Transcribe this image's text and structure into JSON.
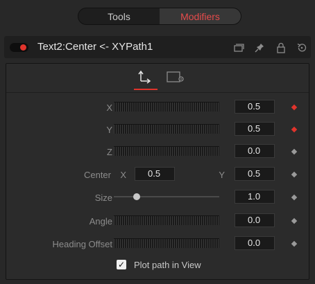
{
  "tabs": {
    "tools": "Tools",
    "modifiers": "Modifiers"
  },
  "header": {
    "title": "Text2:Center <- XYPath1",
    "enabled": true
  },
  "panel_tabs": [
    {
      "name": "controls-tab-icon",
      "active": true
    },
    {
      "name": "settings-tab-icon",
      "active": false
    }
  ],
  "rows": {
    "x": {
      "label": "X",
      "value": "0.5",
      "keyframed": true
    },
    "y": {
      "label": "Y",
      "value": "0.5",
      "keyframed": true
    },
    "z": {
      "label": "Z",
      "value": "0.0",
      "keyframed": false
    },
    "center": {
      "label": "Center",
      "x_label": "X",
      "x_value": "0.5",
      "y_label": "Y",
      "y_value": "0.5",
      "keyframed": false
    },
    "size": {
      "label": "Size",
      "value": "1.0",
      "keyframed": false,
      "slider_level": 0.2
    },
    "angle": {
      "label": "Angle",
      "value": "0.0",
      "keyframed": false
    },
    "heading_offset": {
      "label": "Heading Offset",
      "value": "0.0",
      "keyframed": false
    }
  },
  "plot_path": {
    "label": "Plot path in View",
    "checked": true,
    "mark": "✓"
  },
  "colors": {
    "accent": "#e0342c",
    "panel": "#2b2b2b",
    "field": "#1a1a1a"
  }
}
